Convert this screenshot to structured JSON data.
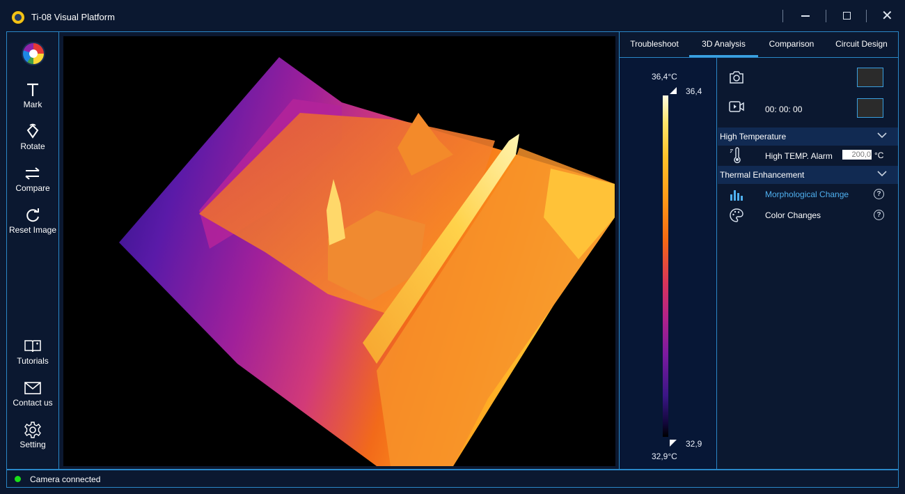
{
  "app": {
    "title": "Ti-08 Visual Platform"
  },
  "sidebar": {
    "items": [
      {
        "label": "Mark",
        "icon": "text-mark-icon"
      },
      {
        "label": "Rotate",
        "icon": "rotate-icon"
      },
      {
        "label": "Compare",
        "icon": "compare-arrows-icon"
      },
      {
        "label": "Reset Image",
        "icon": "reset-icon"
      }
    ],
    "bottom_items": [
      {
        "label": "Tutorials",
        "icon": "book-icon"
      },
      {
        "label": "Contact us",
        "icon": "mail-icon"
      },
      {
        "label": "Setting",
        "icon": "gear-icon"
      }
    ]
  },
  "tabs": [
    {
      "label": "Troubleshoot",
      "active": false
    },
    {
      "label": "3D Analysis",
      "active": true
    },
    {
      "label": "Comparison",
      "active": false
    },
    {
      "label": "Circuit Design",
      "active": false
    }
  ],
  "colorbar": {
    "max_label": "36,4°C",
    "min_label": "32,9°C",
    "max_value": "36,4",
    "min_value": "32,9"
  },
  "controls": {
    "timer": "00: 00: 00",
    "high_temperature": {
      "title": "High Temperature",
      "alarm_label": "High TEMP. Alarm",
      "alarm_value": "200,0",
      "unit": "°C"
    },
    "thermal_enhancement": {
      "title": "Thermal Enhancement",
      "morphological_label": "Morphological Change",
      "color_label": "Color Changes"
    },
    "swatch_color": "#2b2b2b",
    "accent_color": "#3aa0e0"
  },
  "status": {
    "text": "Camera connected",
    "color": "#19e019"
  }
}
